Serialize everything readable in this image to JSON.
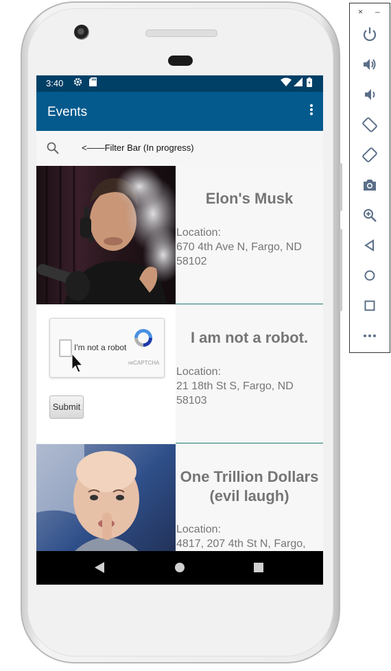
{
  "status_bar": {
    "time": "3:40",
    "icons": [
      "settings-icon",
      "sd-card-icon",
      "wifi-icon",
      "signal-icon",
      "battery-icon"
    ]
  },
  "app_bar": {
    "title": "Events",
    "menu_icon": "overflow-menu-icon"
  },
  "filter_bar": {
    "icon": "search-icon",
    "text": "<——Filter Bar (In progress)"
  },
  "events": [
    {
      "title": "Elon's Musk",
      "location_label": "Location:",
      "address": "670 4th Ave N, Fargo, ND 58102",
      "image": "man-smoking-photo"
    },
    {
      "title": "I am not a robot.",
      "location_label": "Location:",
      "address": "21 18th St S, Fargo, ND 58103",
      "image": "recaptcha-screenshot",
      "captcha_text": "I'm not a robot",
      "captcha_brand": "reCAPTCHA",
      "submit_label": "Submit"
    },
    {
      "title": "One Trillion Dollars (evil laugh)",
      "location_label": "Location:",
      "address": "4817, 207 4th St N, Fargo,",
      "image": "dr-evil-photo"
    }
  ],
  "nav_bar": {
    "buttons": [
      "back-icon",
      "home-icon",
      "recents-icon"
    ]
  },
  "emulator_panel": {
    "window_controls": [
      "×",
      "–"
    ],
    "buttons": [
      "power-icon",
      "volume-up-icon",
      "volume-down-icon",
      "rotate-left-icon",
      "rotate-right-icon",
      "camera-icon",
      "zoom-icon",
      "back-icon",
      "home-icon",
      "overview-icon",
      "more-icon"
    ]
  },
  "colors": {
    "status_bar": "#003f66",
    "app_bar": "#045a8d",
    "divider": "#1f7a73",
    "text_gray": "#757575"
  }
}
